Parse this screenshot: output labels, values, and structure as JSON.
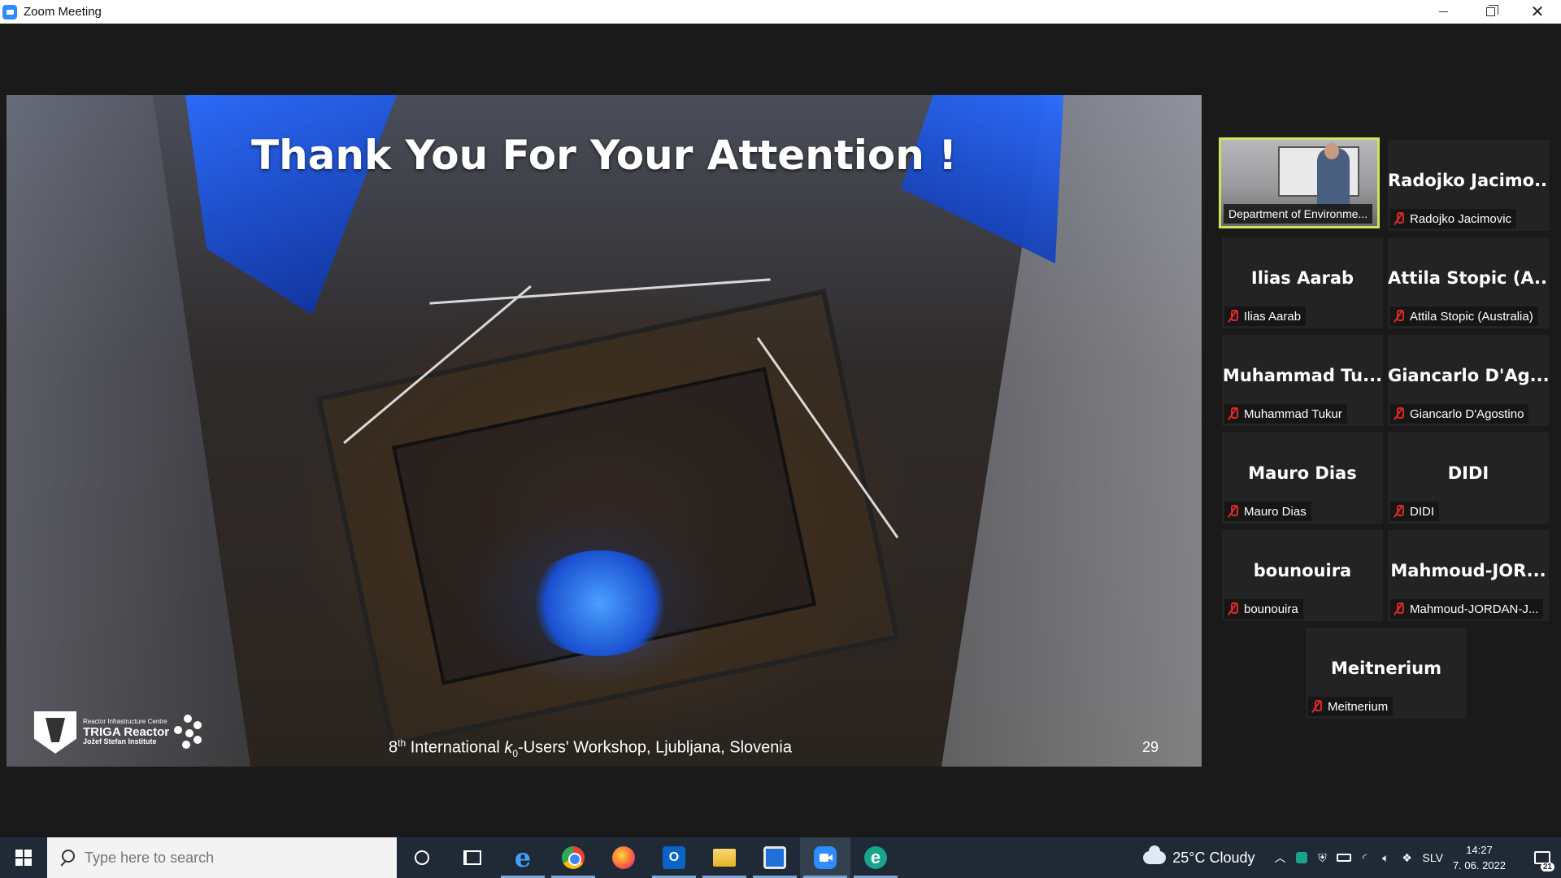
{
  "window": {
    "title": "Zoom Meeting"
  },
  "slide": {
    "title": "Thank You For Your Attention !",
    "footer_prefix": "8",
    "footer_ordinal": "th",
    "footer_mid": " International ",
    "footer_k": "k",
    "footer_sub": "0",
    "footer_suffix": "-Users' Workshop, Ljubljana, Slovenia",
    "page_number": "29",
    "logo_line1": "Reactor Infrastructure Centre",
    "logo_line2": "TRIGA Reactor",
    "logo_line3": "Jožef Stefan Institute"
  },
  "participants": [
    {
      "display": "",
      "label": "Department of Environme...",
      "video": true,
      "muted": false
    },
    {
      "display": "Radojko  Jacimo...",
      "label": "Radojko Jacimovic",
      "video": false,
      "muted": true
    },
    {
      "display": "Ilias Aarab",
      "label": "Ilias Aarab",
      "video": false,
      "muted": true
    },
    {
      "display": "Attila Stopic (A...",
      "label": "Attila Stopic (Australia)",
      "video": false,
      "muted": true
    },
    {
      "display": "Muhammad  Tu...",
      "label": "Muhammad Tukur",
      "video": false,
      "muted": true
    },
    {
      "display": "Giancarlo  D'Ag...",
      "label": "Giancarlo D'Agostino",
      "video": false,
      "muted": true
    },
    {
      "display": "Mauro Dias",
      "label": "Mauro Dias",
      "video": false,
      "muted": true
    },
    {
      "display": "DIDI",
      "label": "DIDI",
      "video": false,
      "muted": true
    },
    {
      "display": "bounouira",
      "label": "bounouira",
      "video": false,
      "muted": true
    },
    {
      "display": "Mahmoud-JOR...",
      "label": "Mahmoud-JORDAN-J...",
      "video": false,
      "muted": true
    },
    {
      "display": "Meitnerium",
      "label": "Meitnerium",
      "video": false,
      "muted": true
    }
  ],
  "taskbar": {
    "search_placeholder": "Type here to search",
    "weather": "25°C  Cloudy",
    "language": "SLV",
    "time": "14:27",
    "date": "7. 06. 2022",
    "notification_count": "21",
    "apps": [
      "cortana-icon",
      "task-view-icon",
      "internet-explorer-icon",
      "chrome-icon",
      "firefox-icon",
      "outlook-icon",
      "file-explorer-icon",
      "app-icon",
      "zoom-icon",
      "edge-icon"
    ]
  },
  "colors": {
    "active_speaker_border": "#c9e65a",
    "muted_icon": "#e02828",
    "zoom_blue": "#2d8cff",
    "taskbar_bg": "#1f2a36"
  }
}
